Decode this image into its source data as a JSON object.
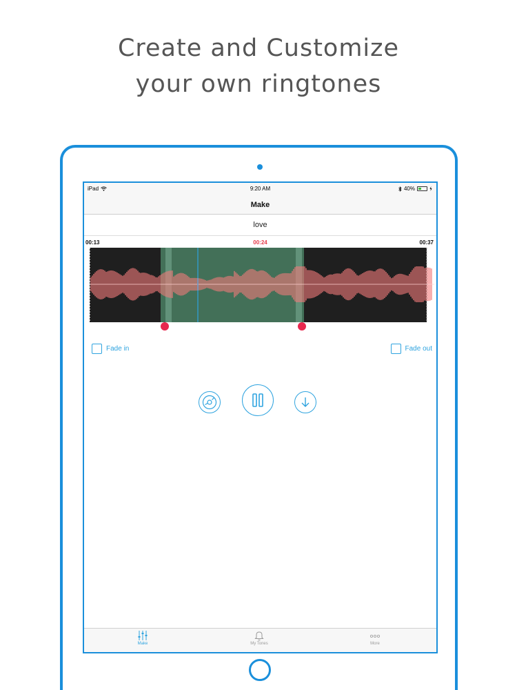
{
  "headline": {
    "line1": "Create and Customize",
    "line2": "your own ringtones"
  },
  "status_bar": {
    "device": "iPad",
    "time": "9:20 AM",
    "battery": "40%",
    "battery_level": 0.4
  },
  "nav": {
    "title": "Make"
  },
  "song": {
    "title": "love"
  },
  "timeline": {
    "start": "00:13",
    "current": "00:24",
    "end": "00:37"
  },
  "waveform": {
    "background_color": "#1f1f1f",
    "wave_color": "#f07a7a",
    "selection_color": "#4a7f63",
    "playhead_color": "#2ea3df"
  },
  "fade": {
    "in_label": "Fade in",
    "out_label": "Fade out"
  },
  "controls": {
    "left_icon": "disc-icon",
    "center_icon": "pause-icon",
    "right_icon": "download-icon"
  },
  "tabs": [
    {
      "label": "Make",
      "icon": "sliders-icon",
      "active": true
    },
    {
      "label": "My Tones",
      "icon": "bell-icon",
      "active": false
    },
    {
      "label": "More",
      "icon": "more-dots-icon",
      "active": false
    }
  ],
  "colors": {
    "accent": "#2ea3df",
    "device_frame": "#1a8fdb",
    "handle": "#e8284e",
    "current_time": "#e63c4a"
  }
}
